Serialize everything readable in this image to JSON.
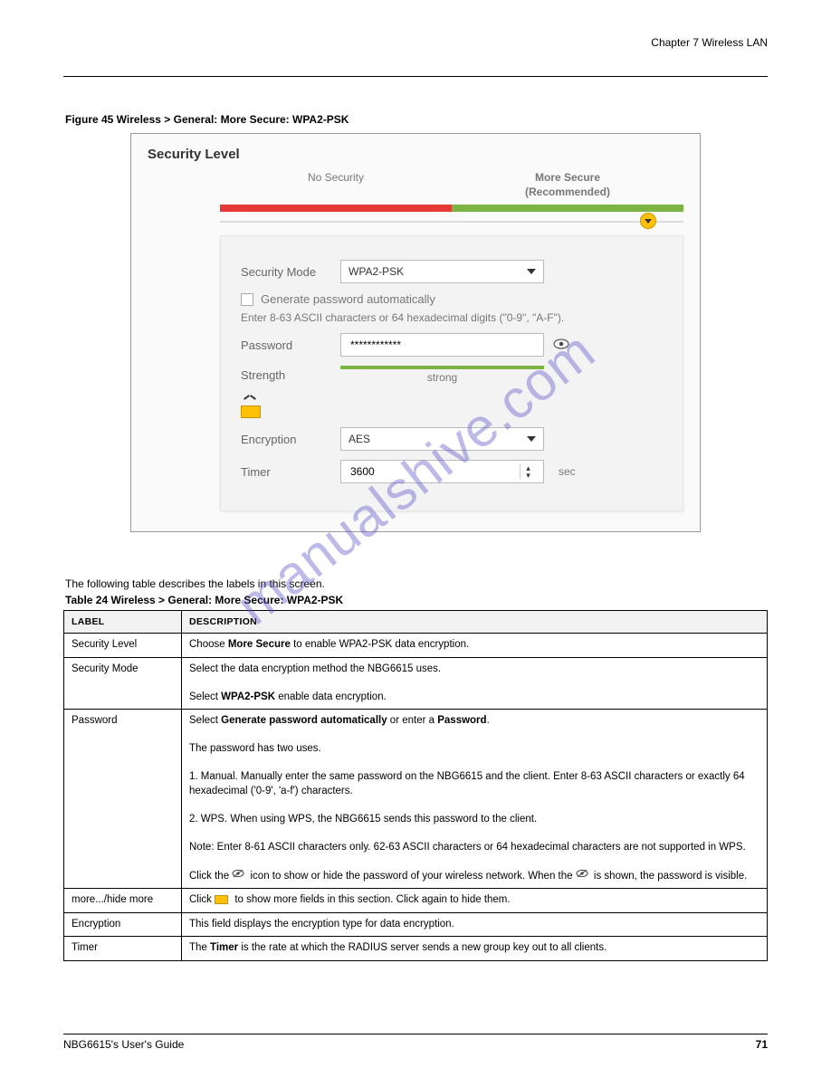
{
  "header": {
    "chapter_right": "Chapter 7 Wireless LAN"
  },
  "figure": {
    "caption": "Figure 45   Wireless > General: More Secure: WPA2-PSK"
  },
  "panel": {
    "title": "Security Level",
    "no_security_label": "No Security",
    "more_secure_label": "More Secure",
    "recommended_label": "(Recommended)",
    "security_mode_label": "Security Mode",
    "security_mode_value": "WPA2-PSK",
    "generate_password_label": "Generate password automatically",
    "hint": "Enter 8-63 ASCII characters or 64 hexadecimal digits (\"0-9\", \"A-F\").",
    "password_label": "Password",
    "password_value": "************",
    "strength_label": "Strength",
    "strength_value": "strong",
    "encryption_label": "Encryption",
    "encryption_value": "AES",
    "timer_label": "Timer",
    "timer_value": "3600",
    "timer_unit": "sec"
  },
  "table": {
    "intro": "The following table describes the labels in this screen.",
    "caption": "Table 24   Wireless > General: More Secure: WPA2-PSK",
    "col_label": "LABEL",
    "col_desc": "DESCRIPTION",
    "rows": [
      {
        "label": "Security Level",
        "desc": "Choose More Secure to enable WPA2-PSK data encryption."
      },
      {
        "label": "Security Mode",
        "desc": "Select the data encryption method the NBG6615 uses.\n\nSelect WPA2-PSK enable data encryption."
      },
      {
        "label": "Password",
        "desc": "Select Generate password automatically or enter a Password.\n\nThe password has two uses.\n\n1. Manual. Manually enter the same password on the NBG6615 and the client. Enter 8-63 ASCII characters or exactly 64 hexadecimal ('0-9', 'a-f') characters.\n\n2. WPS. When using WPS, the NBG6615 sends this password to the client.\n\nNote: Enter 8-61 ASCII characters only. 62-63 ASCII characters or 64 hexadecimal characters are not supported in WPS.\n\nClick the [eye-slash] icon to show or hide the password of your wireless network. When the [eye-slash] is shown, the password is visible."
      },
      {
        "label": "more.../hide more",
        "desc": "Click [folder] to show more fields in this section. Click again to hide them."
      },
      {
        "label": "Encryption",
        "desc": "This field displays the encryption type for data encryption."
      },
      {
        "label": "Timer",
        "desc": "The Timer is the rate at which the RADIUS server sends a new group key out to all clients."
      }
    ]
  },
  "footer": {
    "left": "NBG6615's User's Guide",
    "page": "71"
  },
  "watermark": "manualshive.com"
}
